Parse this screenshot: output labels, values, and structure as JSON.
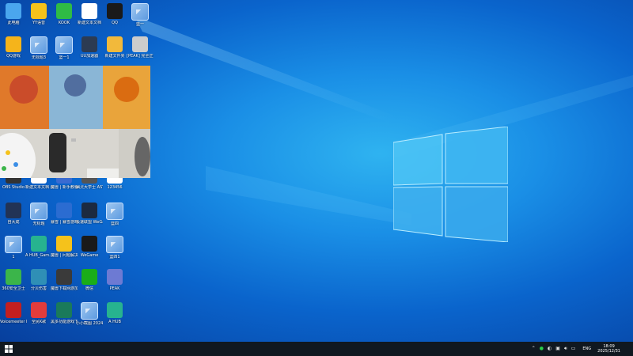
{
  "desktop_icons": [
    {
      "label": "此电脑",
      "color": "#4aa6ee"
    },
    {
      "label": "YY语音",
      "color": "#f5c21b"
    },
    {
      "label": "KOOK",
      "color": "#2fbb45"
    },
    {
      "label": "新建文本文档",
      "color": "#ffffff"
    },
    {
      "label": "QQ",
      "color": "#1a1a1a"
    },
    {
      "label": "篮一",
      "color": "#7fb3ee"
    },
    {
      "label": "QQ游戏",
      "color": "#f5b41b"
    },
    {
      "label": "无标题3",
      "color": "#7fb3ee"
    },
    {
      "label": "篮一1",
      "color": "#7fb3ee"
    },
    {
      "label": "UU加速器",
      "color": "#2c3b52"
    },
    {
      "label": "新建文件夹",
      "color": "#f2b93b"
    },
    {
      "label": "[PEAK] 完全正式版 v2.2",
      "color": "#cccccc"
    },
    {
      "label": "OBS Studio",
      "color": "#333333"
    },
    {
      "label": "新建文本文档 (4)",
      "color": "#ffffff"
    },
    {
      "label": "魔兽 | 新手教程",
      "color": "#3a6bd1"
    },
    {
      "label": "幽灵大学士 ASTUBR...",
      "color": "#555555"
    },
    {
      "label": "123456",
      "color": "#ffffff"
    },
    {
      "label": "自大成",
      "color": "#223355"
    },
    {
      "label": "无标题",
      "color": "#7fb3ee"
    },
    {
      "label": "暴雪 | 暴雪游戏平台",
      "color": "#2b6cd1"
    },
    {
      "label": "极速联盟 WeGame版",
      "color": "#1c2a40"
    },
    {
      "label": "篮四",
      "color": "#7fb3ee"
    },
    {
      "label": "1",
      "color": "#7fb3ee"
    },
    {
      "label": "A HUB_Gam...",
      "color": "#27b38f"
    },
    {
      "label": "魔兽 | 问题解决大全",
      "color": "#f5c21b"
    },
    {
      "label": "WeGame",
      "color": "#1a1a1a"
    },
    {
      "label": "篮四1",
      "color": "#7fb3ee"
    },
    {
      "label": "360安全卫士",
      "color": "#3bb54a"
    },
    {
      "label": "分贝伤害",
      "color": "#2f8fb6"
    },
    {
      "label": "魔兽下载网游加速",
      "color": "#3a3a3a"
    },
    {
      "label": "微信",
      "color": "#1aad19"
    },
    {
      "label": "PEAK",
      "color": "#6d7ad3"
    },
    {
      "label": "Voicemeeter Banana",
      "color": "#c31f1f"
    },
    {
      "label": "全民K歌",
      "color": "#e23c3c"
    },
    {
      "label": "黑多功能游戏下载",
      "color": "#1a7a5a"
    },
    {
      "label": "小小截图 20241125...",
      "color": "#7fb3ee"
    },
    {
      "label": "A HUB",
      "color": "#27b38f"
    }
  ],
  "taskbar": {
    "tray_icons": [
      "chevron-up-icon",
      "wechat-icon",
      "steam-icon",
      "network-icon",
      "volume-icon",
      "battery-icon"
    ],
    "language": "ENG",
    "time": "18:09",
    "date": "2025/12/31"
  }
}
